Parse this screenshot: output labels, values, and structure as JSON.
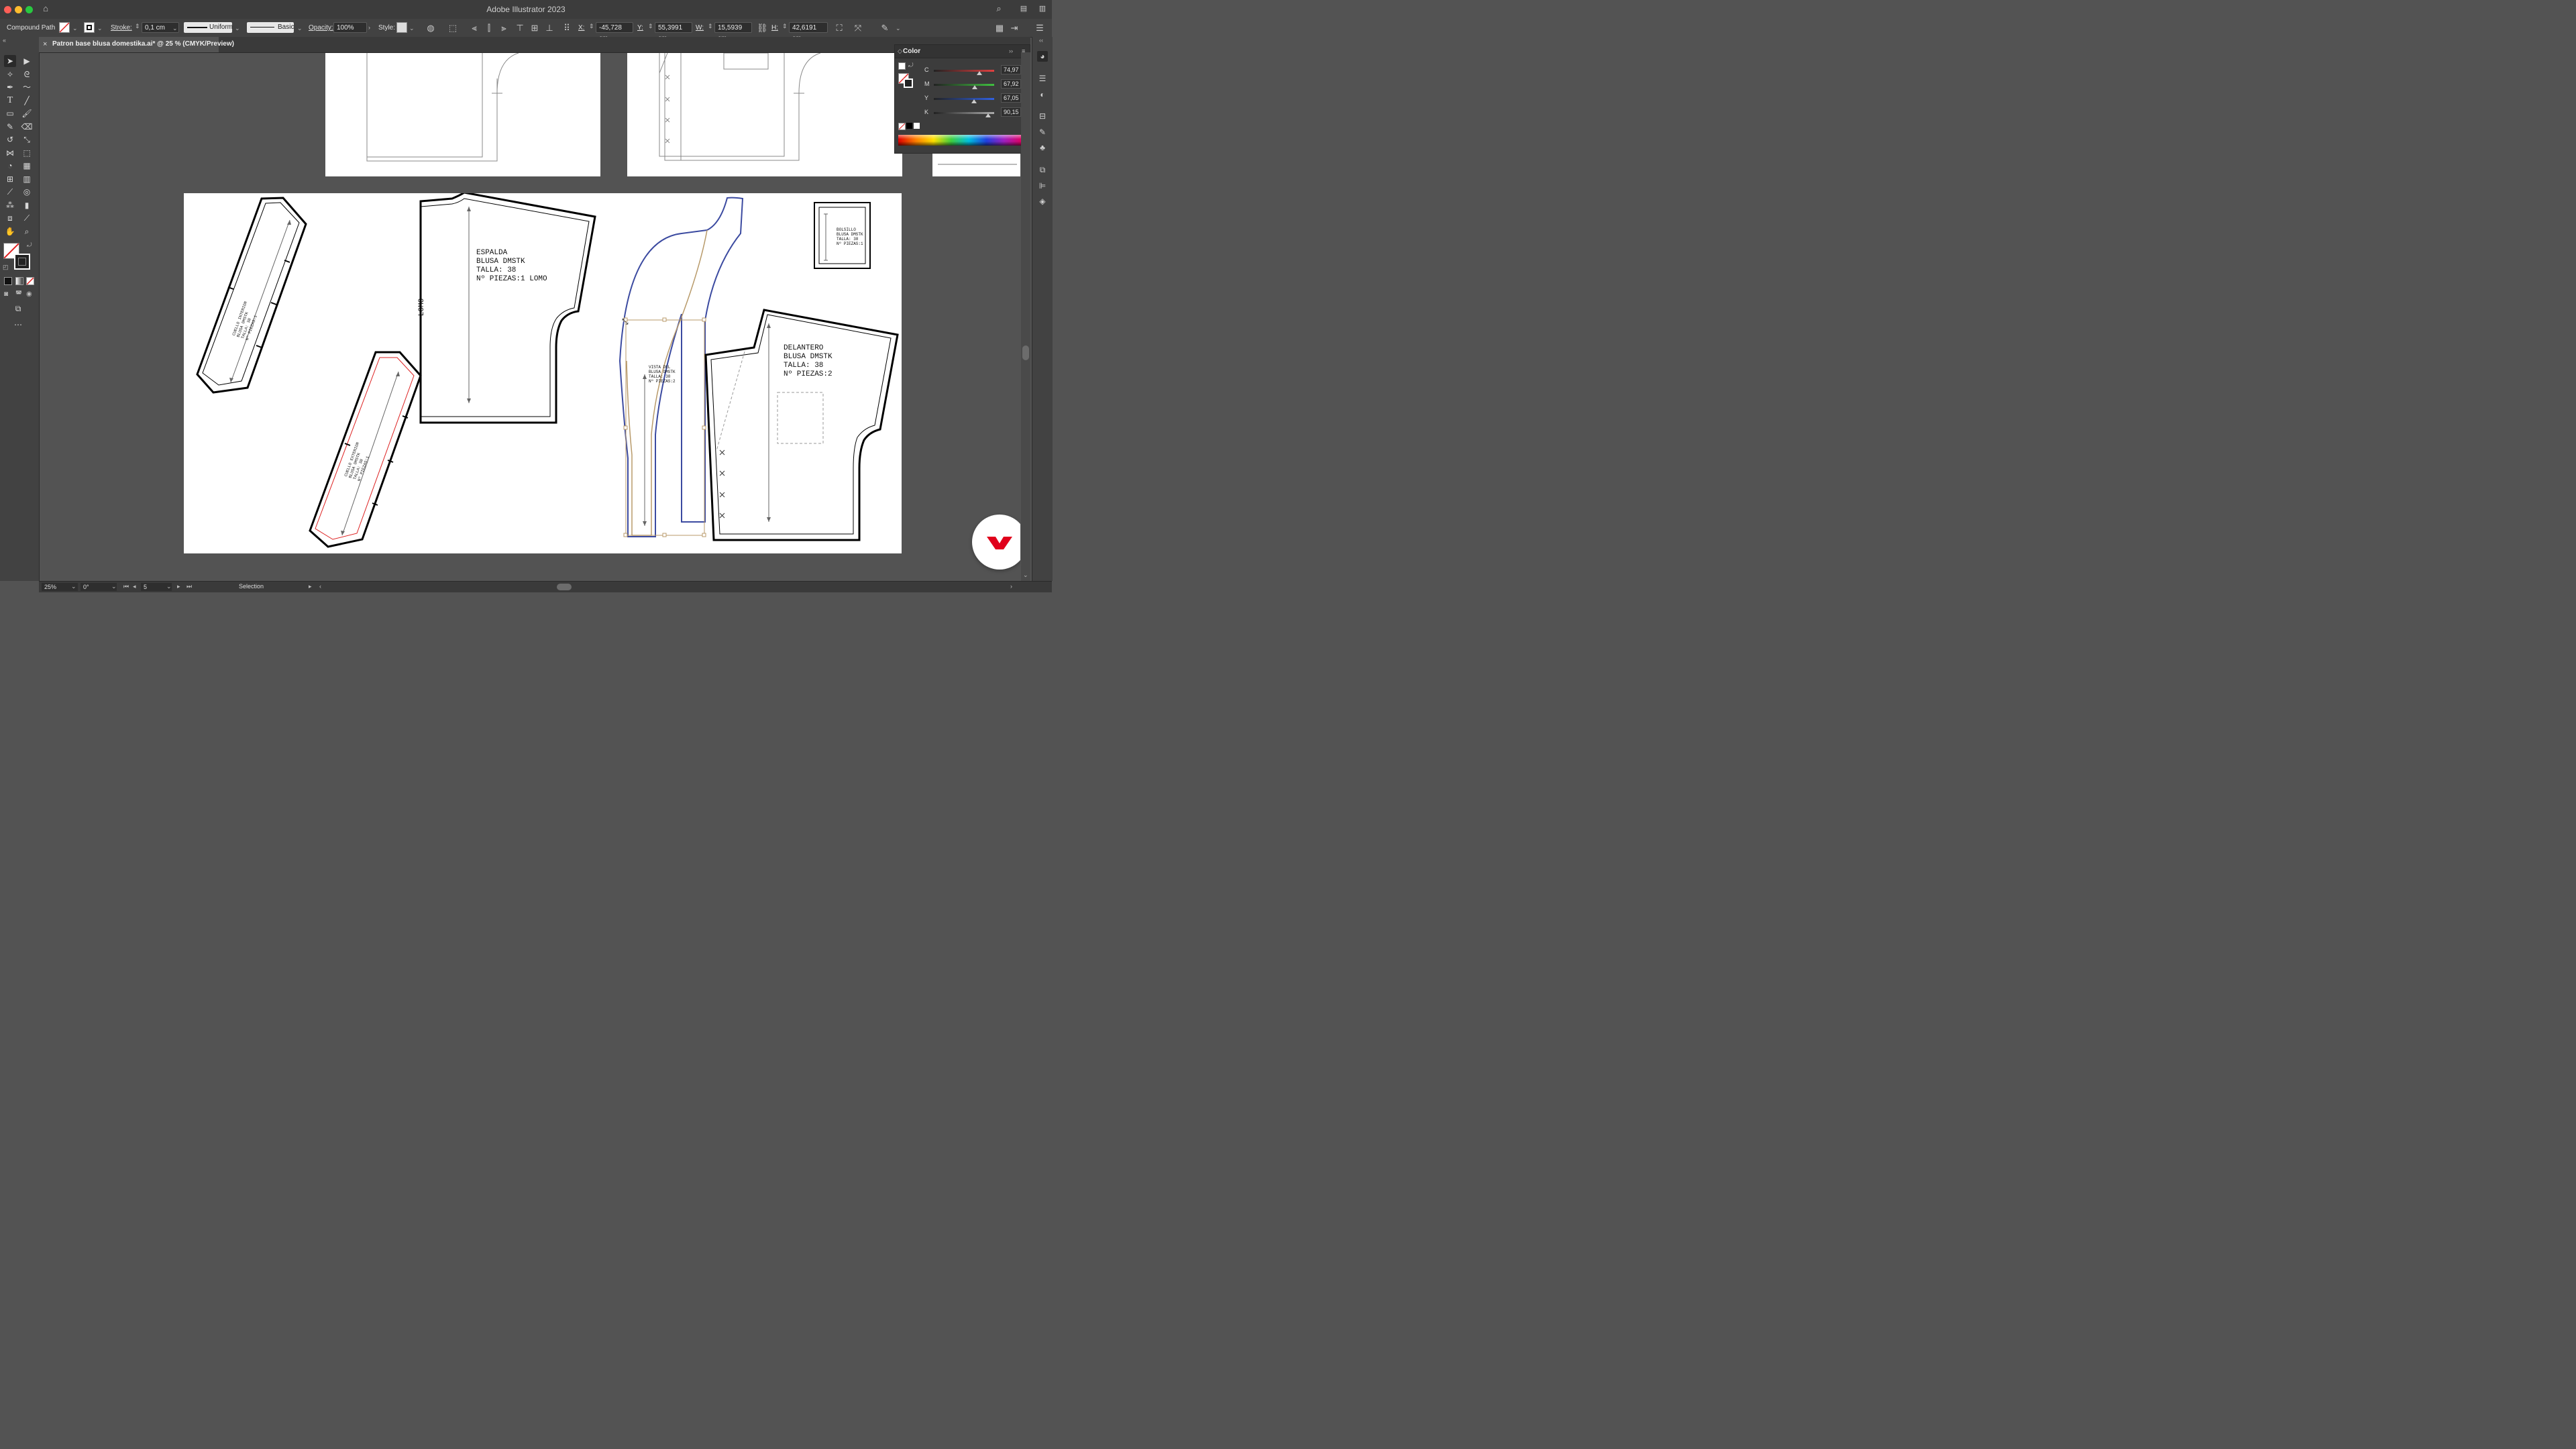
{
  "app": {
    "title": "Adobe Illustrator 2023"
  },
  "control_bar": {
    "selection_type": "Compound Path",
    "stroke_label": "Stroke:",
    "stroke_value": "0,1 cm",
    "profile": "Uniform",
    "brush": "Basic",
    "opacity_label": "Opacity:",
    "opacity_value": "100%",
    "style_label": "Style:",
    "x_label": "X:",
    "x_value": "-45,728 cm",
    "y_label": "Y:",
    "y_value": "55,3991 cm",
    "w_label": "W:",
    "w_value": "15,5939 cm",
    "h_label": "H:",
    "h_value": "42,6191 cm"
  },
  "document_tab": {
    "close": "×",
    "label": "Patron base blusa domestika.ai* @ 25 % (CMYK/Preview)"
  },
  "color_panel": {
    "title": "Color",
    "channels": [
      {
        "label": "C",
        "value": "74,97",
        "unit": "%",
        "level": 0.75,
        "color": "#e04040"
      },
      {
        "label": "M",
        "value": "67,92",
        "unit": "%",
        "level": 0.68,
        "color": "#40c040"
      },
      {
        "label": "Y",
        "value": "67,05",
        "unit": "%",
        "level": 0.67,
        "color": "#3060e0"
      },
      {
        "label": "K",
        "value": "90,15",
        "unit": "%",
        "level": 0.9,
        "color": "#aaaaaa"
      }
    ]
  },
  "pieces": {
    "cuello_interior": [
      "CUELLO INTERIOR",
      "BLUSA DMSTK",
      "TALLA: 38",
      "Nº PIEZAS:1"
    ],
    "cuello_exterior": [
      "CUELLO EXTERIOR",
      "BLUSA DMSTK",
      "TALLA: 38",
      "Nº PIEZAS:1"
    ],
    "espalda": [
      "ESPALDA",
      "BLUSA DMSTK",
      "TALLA: 38",
      "Nº PIEZAS:1 LOMO"
    ],
    "lomo": "LOMO",
    "vista": [
      "VISTA DEL",
      "BLUSA DMSTK",
      "TALLA: 38",
      "Nº PIEZAS:2"
    ],
    "delantero": [
      "DELANTERO",
      "BLUSA DMSTK",
      "TALLA: 38",
      "Nº PIEZAS:2"
    ],
    "bolsillo": [
      "BOLSILLO",
      "BLUSA DMSTK",
      "TALLA: 38",
      "Nº PIEZAS:1"
    ]
  },
  "status_bar": {
    "zoom": "25%",
    "rotation": "0°",
    "artboard": "5",
    "tool": "Selection"
  },
  "icons": {
    "home": "home-icon",
    "search": "search-icon",
    "workspace": "workspace-icon",
    "brand": "domestika-logo"
  }
}
